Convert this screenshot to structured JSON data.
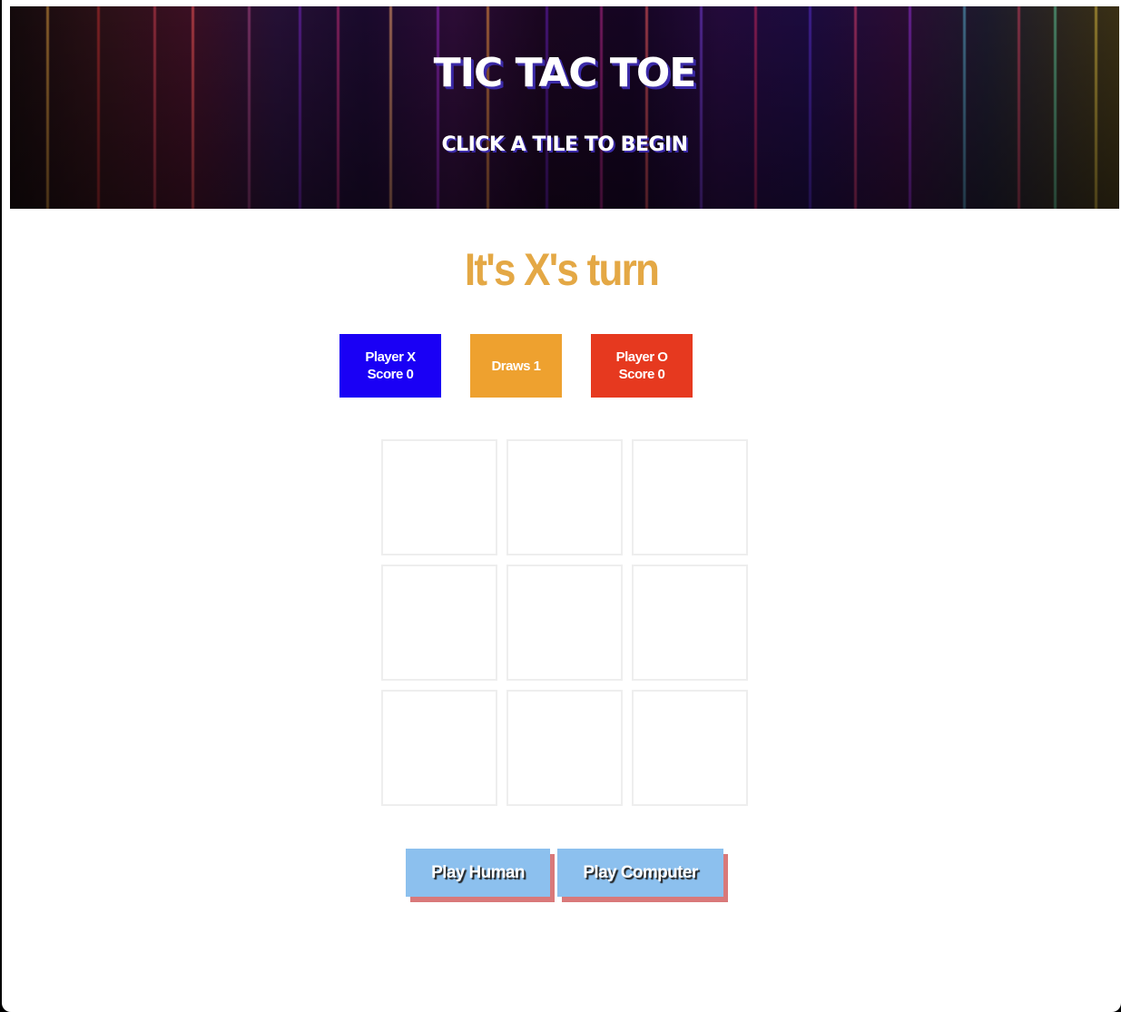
{
  "header": {
    "title": "TIC TAC TOE",
    "subtitle": "CLICK A TILE TO BEGIN"
  },
  "status": {
    "turn_text": "It's X's turn"
  },
  "scoreboard": {
    "player_x": {
      "line1": "Player X",
      "line2": "Score 0",
      "color": "#1a00f5"
    },
    "draws": {
      "label": "Draws 1",
      "color": "#eea12f"
    },
    "player_o": {
      "line1": "Player O",
      "line2": "Score 0",
      "color": "#e6391f"
    }
  },
  "board": {
    "tiles": [
      "",
      "",
      "",
      "",
      "",
      "",
      "",
      "",
      ""
    ]
  },
  "buttons": {
    "play_human": "Play Human",
    "play_computer": "Play Computer"
  },
  "colors": {
    "turn_text": "#e4a845",
    "button_bg": "#8cc0ee",
    "button_shadow": "#d9797a"
  }
}
